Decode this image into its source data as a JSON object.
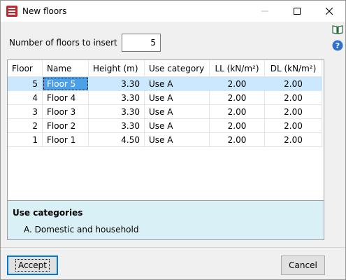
{
  "window": {
    "title": "New floors",
    "controls": [
      "minimize-icon",
      "maximize-icon",
      "close-icon"
    ]
  },
  "form": {
    "floors_label": "Number of floors to insert",
    "floors_value": "5"
  },
  "table": {
    "headers": [
      "Floor",
      "Name",
      "Height (m)",
      "Use category",
      "LL (kN/m²)",
      "DL (kN/m²)"
    ],
    "rows": [
      {
        "floor": "5",
        "name": "Floor 5",
        "height": "3.30",
        "use": "Use A",
        "ll": "2.00",
        "dl": "2.00"
      },
      {
        "floor": "4",
        "name": "Floor 4",
        "height": "3.30",
        "use": "Use A",
        "ll": "2.00",
        "dl": "2.00"
      },
      {
        "floor": "3",
        "name": "Floor 3",
        "height": "3.30",
        "use": "Use A",
        "ll": "2.00",
        "dl": "2.00"
      },
      {
        "floor": "2",
        "name": "Floor 2",
        "height": "3.30",
        "use": "Use A",
        "ll": "2.00",
        "dl": "2.00"
      },
      {
        "floor": "1",
        "name": "Floor 1",
        "height": "4.50",
        "use": "Use A",
        "ll": "2.00",
        "dl": "2.00"
      }
    ],
    "selected_row": 0
  },
  "info": {
    "title": "Use categories",
    "item": "A. Domestic and household"
  },
  "buttons": {
    "accept": "Accept",
    "cancel": "Cancel"
  },
  "colors": {
    "selection": "#cce8ff",
    "info_bg": "#d9f1f6",
    "accept_border": "#0078d7"
  }
}
